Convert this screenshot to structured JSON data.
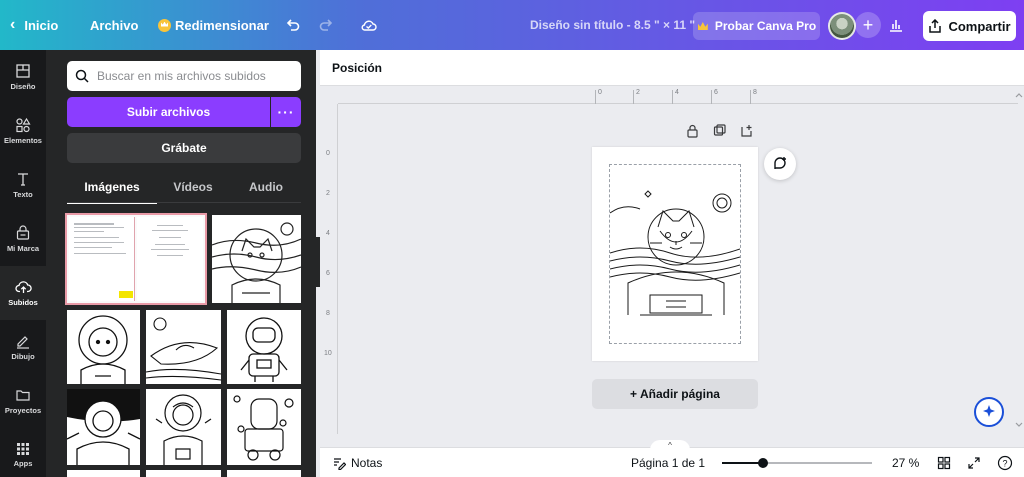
{
  "topbar": {
    "back_label": "Inicio",
    "file_label": "Archivo",
    "resize_label": "Redimensionar",
    "undo_icon": "undo-icon",
    "redo_icon": "redo-icon",
    "cloud_icon": "cloud-check-icon",
    "doc_title": "Diseño sin título - 8.5 \" × 11 \"",
    "pro_label": "Probar Canva Pro",
    "insights_icon": "bar-chart-icon",
    "share_label": "Compartir"
  },
  "rail": [
    {
      "label": "Diseño",
      "icon": "layout-icon"
    },
    {
      "label": "Elementos",
      "icon": "shapes-icon"
    },
    {
      "label": "Texto",
      "icon": "text-icon"
    },
    {
      "label": "Mi Marca",
      "icon": "brand-icon"
    },
    {
      "label": "Subidos",
      "icon": "cloud-upload-icon"
    },
    {
      "label": "Dibujo",
      "icon": "pen-icon"
    },
    {
      "label": "Proyectos",
      "icon": "folder-icon"
    },
    {
      "label": "Apps",
      "icon": "grid-icon"
    }
  ],
  "panel": {
    "search_placeholder": "Buscar en mis archivos subidos",
    "upload_label": "Subir archivos",
    "upload_more": "···",
    "record_label": "Grábate",
    "tabs": [
      "Imágenes",
      "Vídeos",
      "Audio"
    ],
    "active_tab": "Imágenes"
  },
  "editor": {
    "toolbar_label": "Posición",
    "ruler_h": [
      "0",
      "2",
      "4",
      "6",
      "8"
    ],
    "ruler_v": [
      "0",
      "2",
      "4",
      "6",
      "8",
      "10"
    ],
    "add_page_label": "+ Añadir página"
  },
  "bottombar": {
    "notes_label": "Notas",
    "page_label": "Página 1 de 1",
    "zoom_label": "27 %",
    "zoom_fraction": 0.27,
    "help_label": "?"
  },
  "colors": {
    "accent": "#8b3dff",
    "topbar_start": "#22b8c9",
    "topbar_end": "#7e3ff2",
    "panel_bg": "#252627",
    "rail_bg": "#18191b"
  }
}
